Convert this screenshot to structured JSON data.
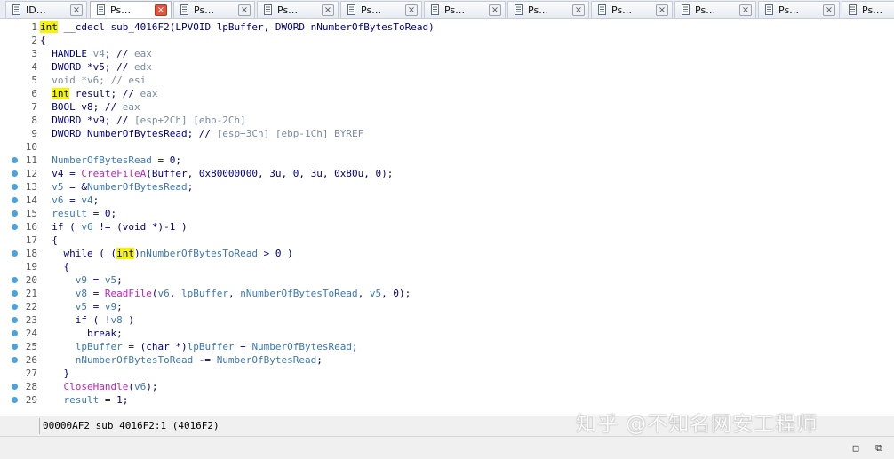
{
  "tabs": [
    {
      "label": "ID…",
      "close": "×"
    },
    {
      "label": "Ps…",
      "close": "×"
    },
    {
      "label": "Ps…",
      "close": "×"
    },
    {
      "label": "Ps…",
      "close": "×"
    },
    {
      "label": "Ps…",
      "close": "×"
    },
    {
      "label": "Ps…",
      "close": "×"
    },
    {
      "label": "Ps…",
      "close": "×"
    },
    {
      "label": "Ps…",
      "close": "×"
    },
    {
      "label": "Ps…",
      "close": "×"
    },
    {
      "label": "Ps…",
      "close": "×"
    },
    {
      "label": "Ps…",
      "close": "×"
    }
  ],
  "code_lines": [
    {
      "num": "1",
      "bp": false,
      "segs": [
        [
          "hl",
          "int"
        ],
        [
          "kw",
          " __cdecl sub_4016F2(LPVOID lpBuffer, DWORD nNumberOfBytesToRead)"
        ]
      ]
    },
    {
      "num": "2",
      "bp": false,
      "segs": [
        [
          "kw",
          "{"
        ]
      ]
    },
    {
      "num": "3",
      "bp": false,
      "segs": [
        [
          "kw",
          "  HANDLE "
        ],
        [
          "gray",
          "v4"
        ],
        [
          "kw",
          "; // "
        ],
        [
          "gray",
          "eax"
        ]
      ]
    },
    {
      "num": "4",
      "bp": false,
      "segs": [
        [
          "kw",
          "  DWORD *"
        ],
        [
          "kw",
          "v5"
        ],
        [
          "kw",
          "; // "
        ],
        [
          "gray",
          "edx"
        ]
      ]
    },
    {
      "num": "5",
      "bp": false,
      "segs": [
        [
          "gray",
          "  void *v6; // esi"
        ]
      ]
    },
    {
      "num": "6",
      "bp": false,
      "segs": [
        [
          "kw",
          "  "
        ],
        [
          "hl",
          "int"
        ],
        [
          "kw",
          " result; // "
        ],
        [
          "gray",
          "eax"
        ]
      ]
    },
    {
      "num": "7",
      "bp": false,
      "segs": [
        [
          "kw",
          "  BOOL v8; // "
        ],
        [
          "gray",
          "eax"
        ]
      ]
    },
    {
      "num": "8",
      "bp": false,
      "segs": [
        [
          "kw",
          "  DWORD *v9; // "
        ],
        [
          "gray",
          "[esp+2Ch] [ebp-2Ch]"
        ]
      ]
    },
    {
      "num": "9",
      "bp": false,
      "segs": [
        [
          "kw",
          "  DWORD NumberOfBytesRead; // "
        ],
        [
          "gray",
          "[esp+3Ch] [ebp-1Ch] BYREF"
        ]
      ]
    },
    {
      "num": "10",
      "bp": false,
      "segs": [
        [
          "kw",
          ""
        ]
      ]
    },
    {
      "num": "11",
      "bp": true,
      "segs": [
        [
          "teal",
          "  NumberOfBytesRead"
        ],
        [
          "kw",
          " = 0;"
        ]
      ]
    },
    {
      "num": "12",
      "bp": true,
      "segs": [
        [
          "kw",
          "  v4 = "
        ],
        [
          "pink",
          "CreateFileA"
        ],
        [
          "kw",
          "(Buffer, 0x80000000, 3u, 0, 3u, 0x80u, 0);"
        ]
      ]
    },
    {
      "num": "13",
      "bp": true,
      "segs": [
        [
          "teal",
          "  v5"
        ],
        [
          "kw",
          " = &"
        ],
        [
          "teal",
          "NumberOfBytesRead"
        ],
        [
          "kw",
          ";"
        ]
      ]
    },
    {
      "num": "14",
      "bp": true,
      "segs": [
        [
          "teal",
          "  v6"
        ],
        [
          "kw",
          " = "
        ],
        [
          "teal",
          "v4"
        ],
        [
          "kw",
          ";"
        ]
      ]
    },
    {
      "num": "15",
      "bp": true,
      "segs": [
        [
          "teal",
          "  result"
        ],
        [
          "kw",
          " = 0;"
        ]
      ]
    },
    {
      "num": "16",
      "bp": true,
      "segs": [
        [
          "kw",
          "  if ( "
        ],
        [
          "teal",
          "v6"
        ],
        [
          "kw",
          " != (void *)-1 )"
        ]
      ]
    },
    {
      "num": "17",
      "bp": false,
      "segs": [
        [
          "kw",
          "  {"
        ]
      ]
    },
    {
      "num": "18",
      "bp": true,
      "segs": [
        [
          "kw",
          "    while ( ("
        ],
        [
          "hl",
          "int"
        ],
        [
          "kw",
          ")"
        ],
        [
          "teal",
          "nNumberOfBytesToRead"
        ],
        [
          "kw",
          " > 0 )"
        ]
      ]
    },
    {
      "num": "19",
      "bp": false,
      "segs": [
        [
          "kw",
          "    {"
        ]
      ]
    },
    {
      "num": "20",
      "bp": true,
      "segs": [
        [
          "teal",
          "      v9"
        ],
        [
          "kw",
          " = "
        ],
        [
          "teal",
          "v5"
        ],
        [
          "kw",
          ";"
        ]
      ]
    },
    {
      "num": "21",
      "bp": true,
      "segs": [
        [
          "teal",
          "      v8"
        ],
        [
          "kw",
          " = "
        ],
        [
          "pink",
          "ReadFile"
        ],
        [
          "kw",
          "("
        ],
        [
          "teal",
          "v6"
        ],
        [
          "kw",
          ", "
        ],
        [
          "teal",
          "lpBuffer"
        ],
        [
          "kw",
          ", "
        ],
        [
          "teal",
          "nNumberOfBytesToRead"
        ],
        [
          "kw",
          ", "
        ],
        [
          "teal",
          "v5"
        ],
        [
          "kw",
          ", 0);"
        ]
      ]
    },
    {
      "num": "22",
      "bp": true,
      "segs": [
        [
          "teal",
          "      v5"
        ],
        [
          "kw",
          " = "
        ],
        [
          "teal",
          "v9"
        ],
        [
          "kw",
          ";"
        ]
      ]
    },
    {
      "num": "23",
      "bp": true,
      "segs": [
        [
          "kw",
          "      if ( !"
        ],
        [
          "teal",
          "v8"
        ],
        [
          "kw",
          " )"
        ]
      ]
    },
    {
      "num": "24",
      "bp": true,
      "segs": [
        [
          "kw",
          "        break;"
        ]
      ]
    },
    {
      "num": "25",
      "bp": true,
      "segs": [
        [
          "teal",
          "      lpBuffer"
        ],
        [
          "kw",
          " = (char *)"
        ],
        [
          "teal",
          "lpBuffer"
        ],
        [
          "kw",
          " + "
        ],
        [
          "teal",
          "NumberOfBytesRead"
        ],
        [
          "kw",
          ";"
        ]
      ]
    },
    {
      "num": "26",
      "bp": true,
      "segs": [
        [
          "teal",
          "      nNumberOfBytesToRead"
        ],
        [
          "kw",
          " -= "
        ],
        [
          "teal",
          "NumberOfBytesRead"
        ],
        [
          "kw",
          ";"
        ]
      ]
    },
    {
      "num": "27",
      "bp": false,
      "segs": [
        [
          "kw",
          "    }"
        ]
      ]
    },
    {
      "num": "28",
      "bp": true,
      "segs": [
        [
          "pink",
          "    CloseHandle"
        ],
        [
          "kw",
          "("
        ],
        [
          "teal",
          "v6"
        ],
        [
          "kw",
          ");"
        ]
      ]
    },
    {
      "num": "29",
      "bp": true,
      "segs": [
        [
          "teal",
          "    result"
        ],
        [
          "kw",
          " = 1;"
        ]
      ]
    }
  ],
  "status": {
    "text": "00000AF2 sub_4016F2:1 (4016F2)"
  },
  "watermark": {
    "text": "知乎 @不知名网安工程师"
  },
  "window_buttons": {
    "restore": "□",
    "close": "⧉"
  },
  "colors": {
    "keyword": "#000080",
    "highlight": "#f5f500",
    "comment": "#7a8aa0",
    "function": "#c31fc3",
    "variable": "#3c78b4",
    "breakpoint": "#4aa3df",
    "active_close": "#e0553d"
  }
}
